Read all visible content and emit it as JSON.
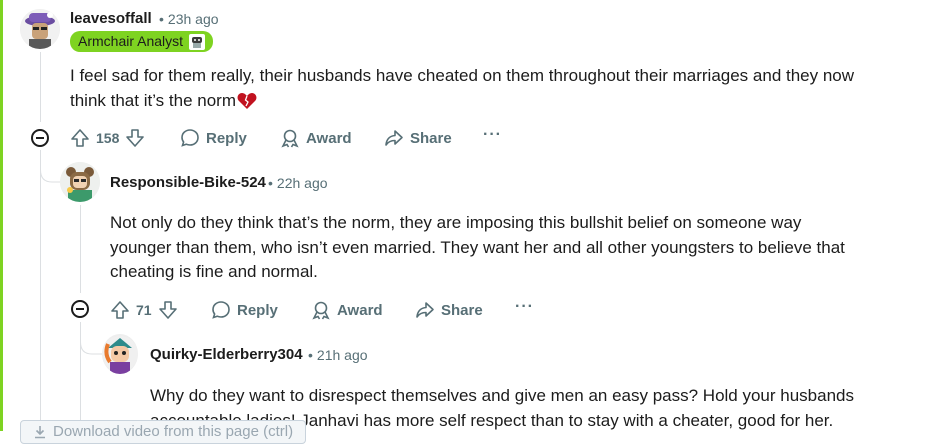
{
  "comments": [
    {
      "username": "leavesoffall",
      "time": "23h ago",
      "flair": "Armchair Analyst",
      "body_lines": [
        "I feel sad for them really, their husbands have cheated on them throughout their marriages and they now",
        "think that it’s the norm"
      ],
      "votes": "158",
      "actions": {
        "reply": "Reply",
        "award": "Award",
        "share": "Share",
        "more": "···"
      }
    },
    {
      "username": "Responsible-Bike-524",
      "time": "22h ago",
      "body_lines": [
        "Not only do they think that’s the norm, they are imposing this bullshit belief on someone way",
        "younger than them, who isn’t even married. They want her and all other youngsters to believe that",
        "cheating is fine and normal."
      ],
      "votes": "71",
      "actions": {
        "reply": "Reply",
        "award": "Award",
        "share": "Share",
        "more": "···"
      }
    },
    {
      "username": "Quirky-Elderberry304",
      "time": "21h ago",
      "body_lines": [
        "Why do they want to disrespect themselves and give men an easy pass? Hold your husbands",
        "accountable ladies! Janhavi has more self respect than to stay with a cheater, good for her."
      ]
    }
  ],
  "toast": {
    "label": "Download video from this page (ctrl)"
  },
  "colors": {
    "flair_bg": "#7ed321",
    "meta": "#576f76",
    "heart": "#c1121f"
  }
}
